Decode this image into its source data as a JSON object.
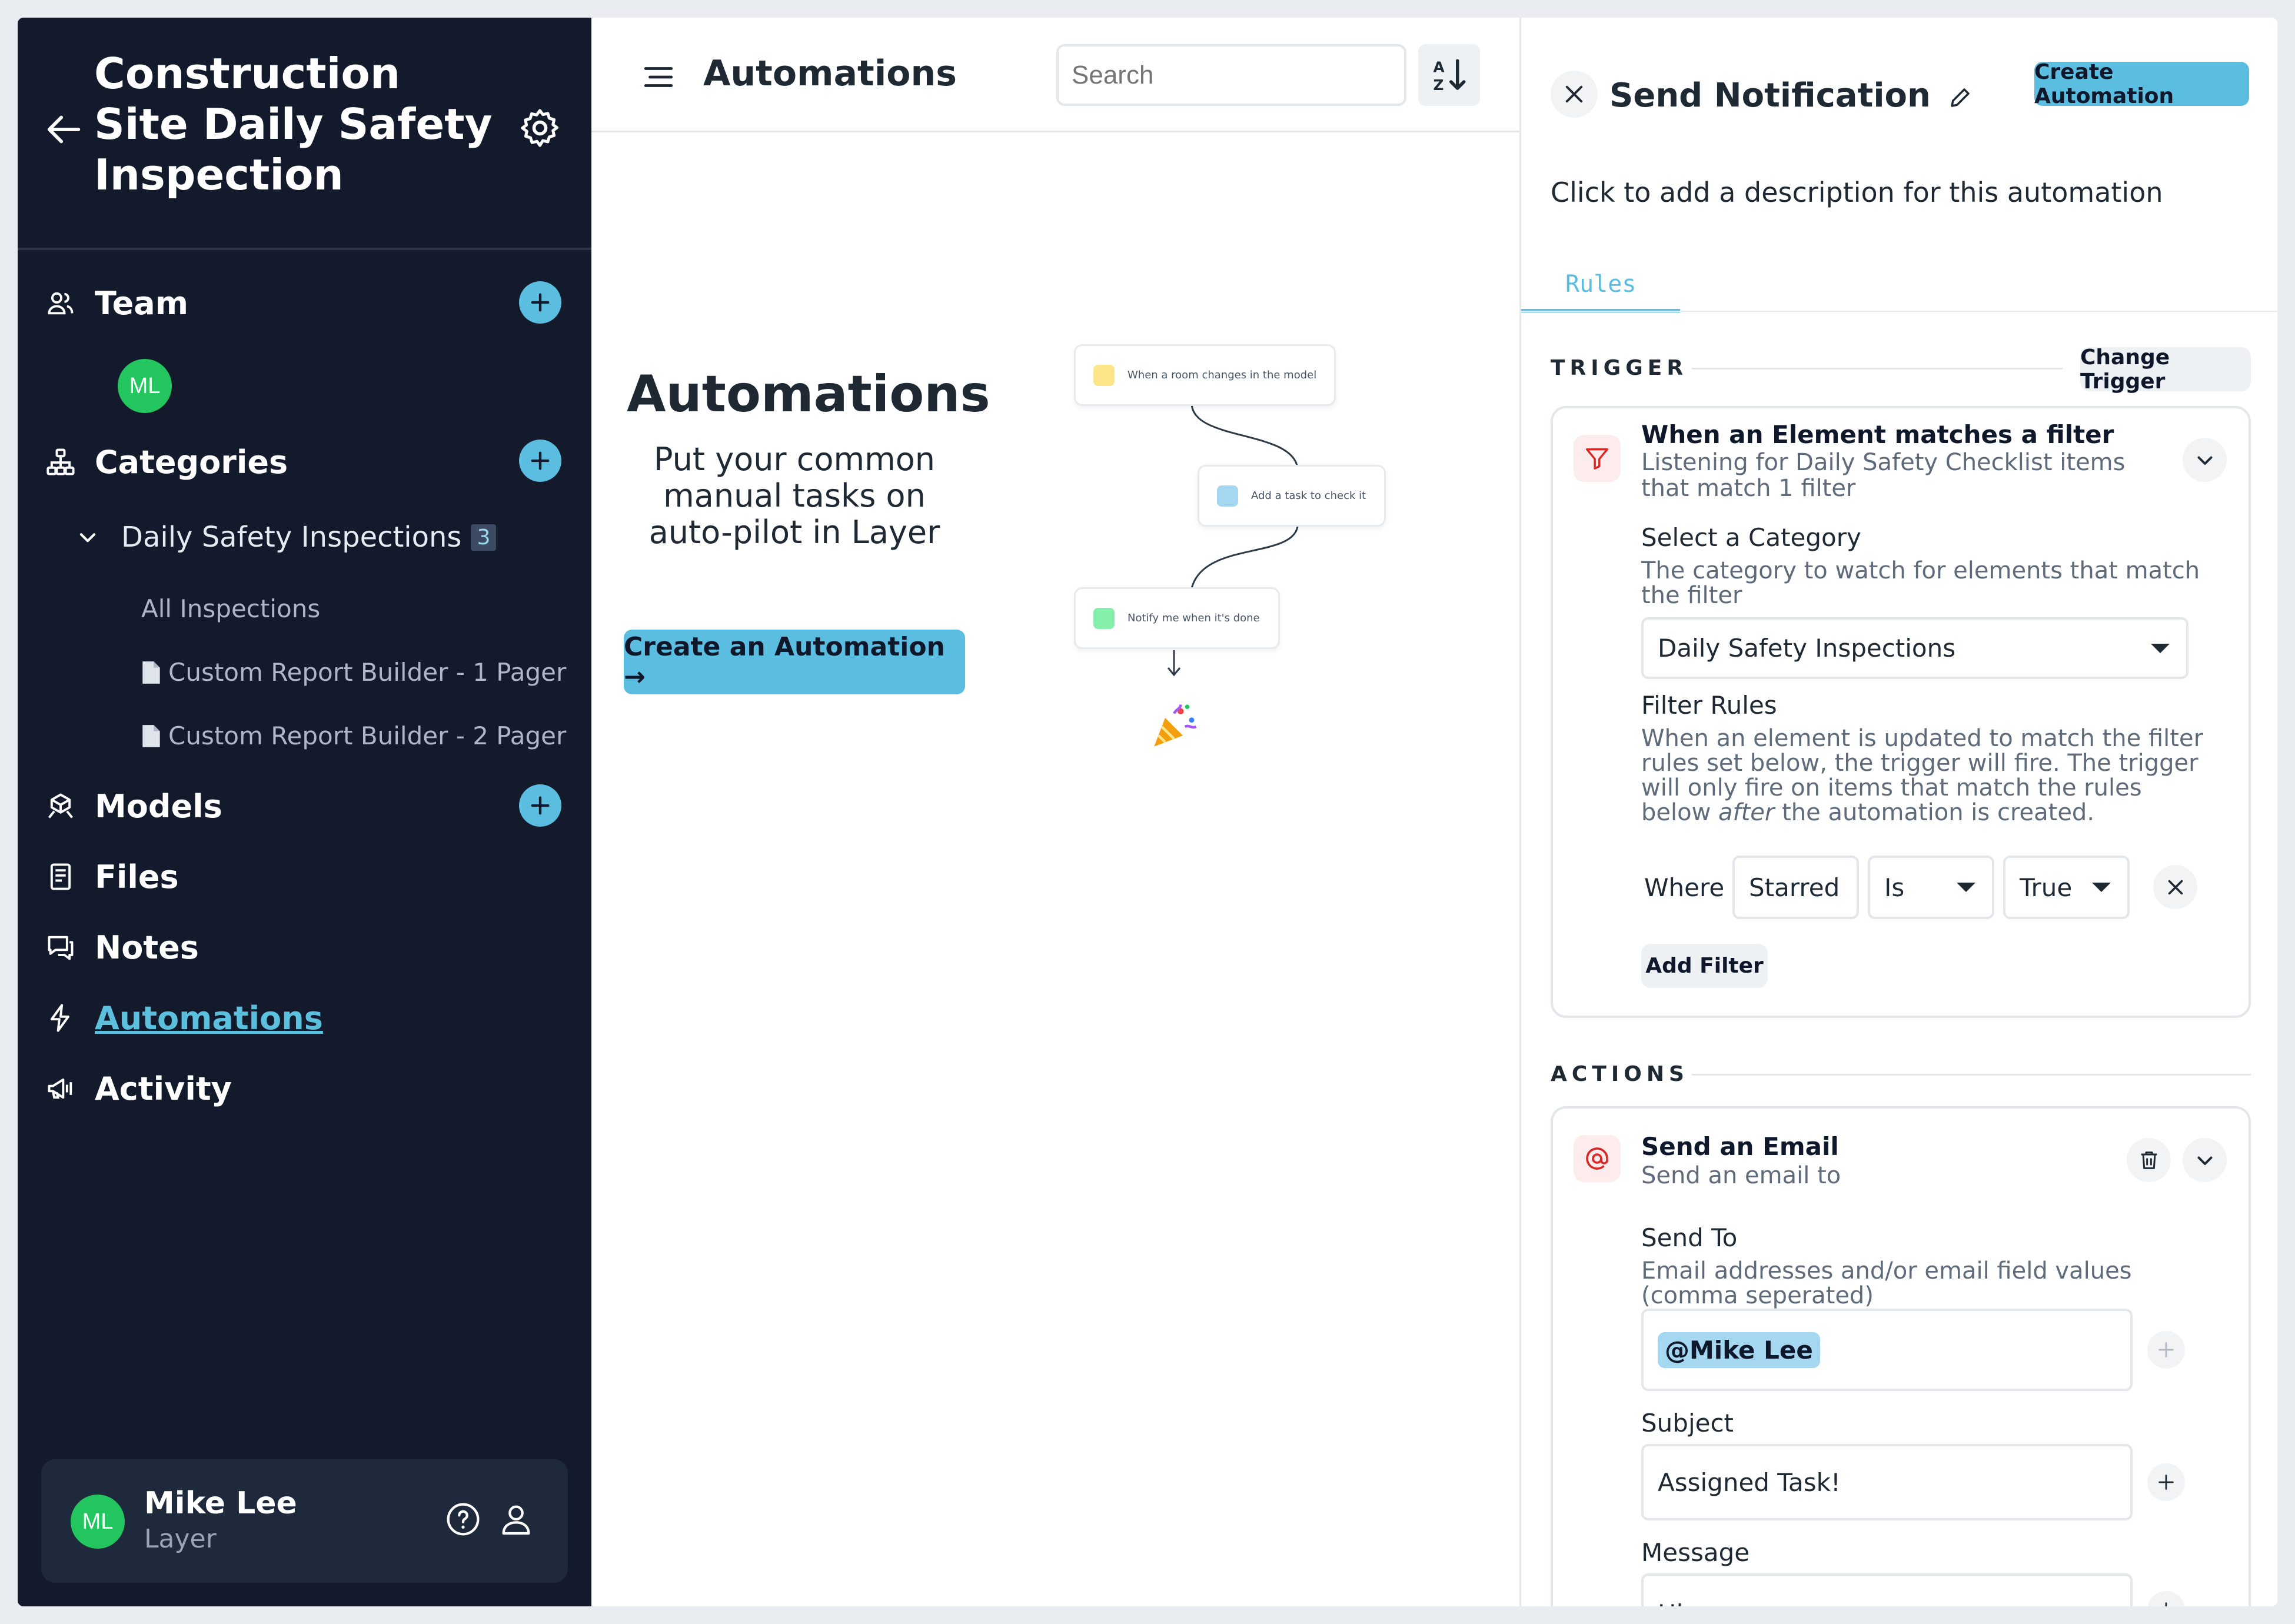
{
  "sidebar": {
    "title": "Construction Site Daily Safety Inspection",
    "nav": {
      "team": "Team",
      "categories": "Categories",
      "models": "Models",
      "files": "Files",
      "notes": "Notes",
      "automations": "Automations",
      "activity": "Activity"
    },
    "team_member_initials": "ML",
    "category": {
      "label": "Daily Safety Inspections",
      "count": "3"
    },
    "category_items": [
      "All Inspections",
      "Custom Report Builder - 1 Pager",
      "Custom Report Builder - 2 Pager"
    ],
    "user": {
      "initials": "ML",
      "name": "Mike Lee",
      "workspace": "Layer"
    }
  },
  "middle": {
    "header_title": "Automations",
    "search_placeholder": "Search",
    "empty_title": "Automations",
    "empty_text": "Put your common manual tasks on auto-pilot in Layer",
    "cta_label": "Create an Automation →",
    "flow": [
      "When a room changes in the model",
      "Add a task to check it",
      "Notify me when it's done"
    ]
  },
  "panel": {
    "title": "Send Notification",
    "create_label": "Create Automation",
    "description": "Click to add a description for this automation",
    "tab": "Rules",
    "trigger_label": "TRIGGER",
    "change_trigger": "Change Trigger",
    "trigger": {
      "title": "When an Element matches a filter",
      "subtitle": "Listening for Daily Safety Checklist items that match 1 filter",
      "select_label": "Select a Category",
      "select_help": "The category to watch for elements that match the filter",
      "select_value": "Daily Safety Inspections",
      "filter_label": "Filter Rules",
      "filter_help": "When an element is updated to match the filter rules set below, the trigger will fire. The trigger will only fire on items that match the rules below",
      "filter_help_em": "after",
      "filter_help_tail": "the automation is created.",
      "where": "Where",
      "field": "Starred",
      "op": "Is",
      "value": "True",
      "add_filter": "Add Filter"
    },
    "actions_label": "ACTIONS",
    "action": {
      "title": "Send an Email",
      "subtitle": "Send an email to",
      "send_to_label": "Send To",
      "send_to_help": "Email addresses and/or email field values (comma seperated)",
      "recipient": "@Mike Lee",
      "subject_label": "Subject",
      "subject_value": "Assigned Task!",
      "message_label": "Message",
      "message_value": "Hi <name>,"
    }
  }
}
